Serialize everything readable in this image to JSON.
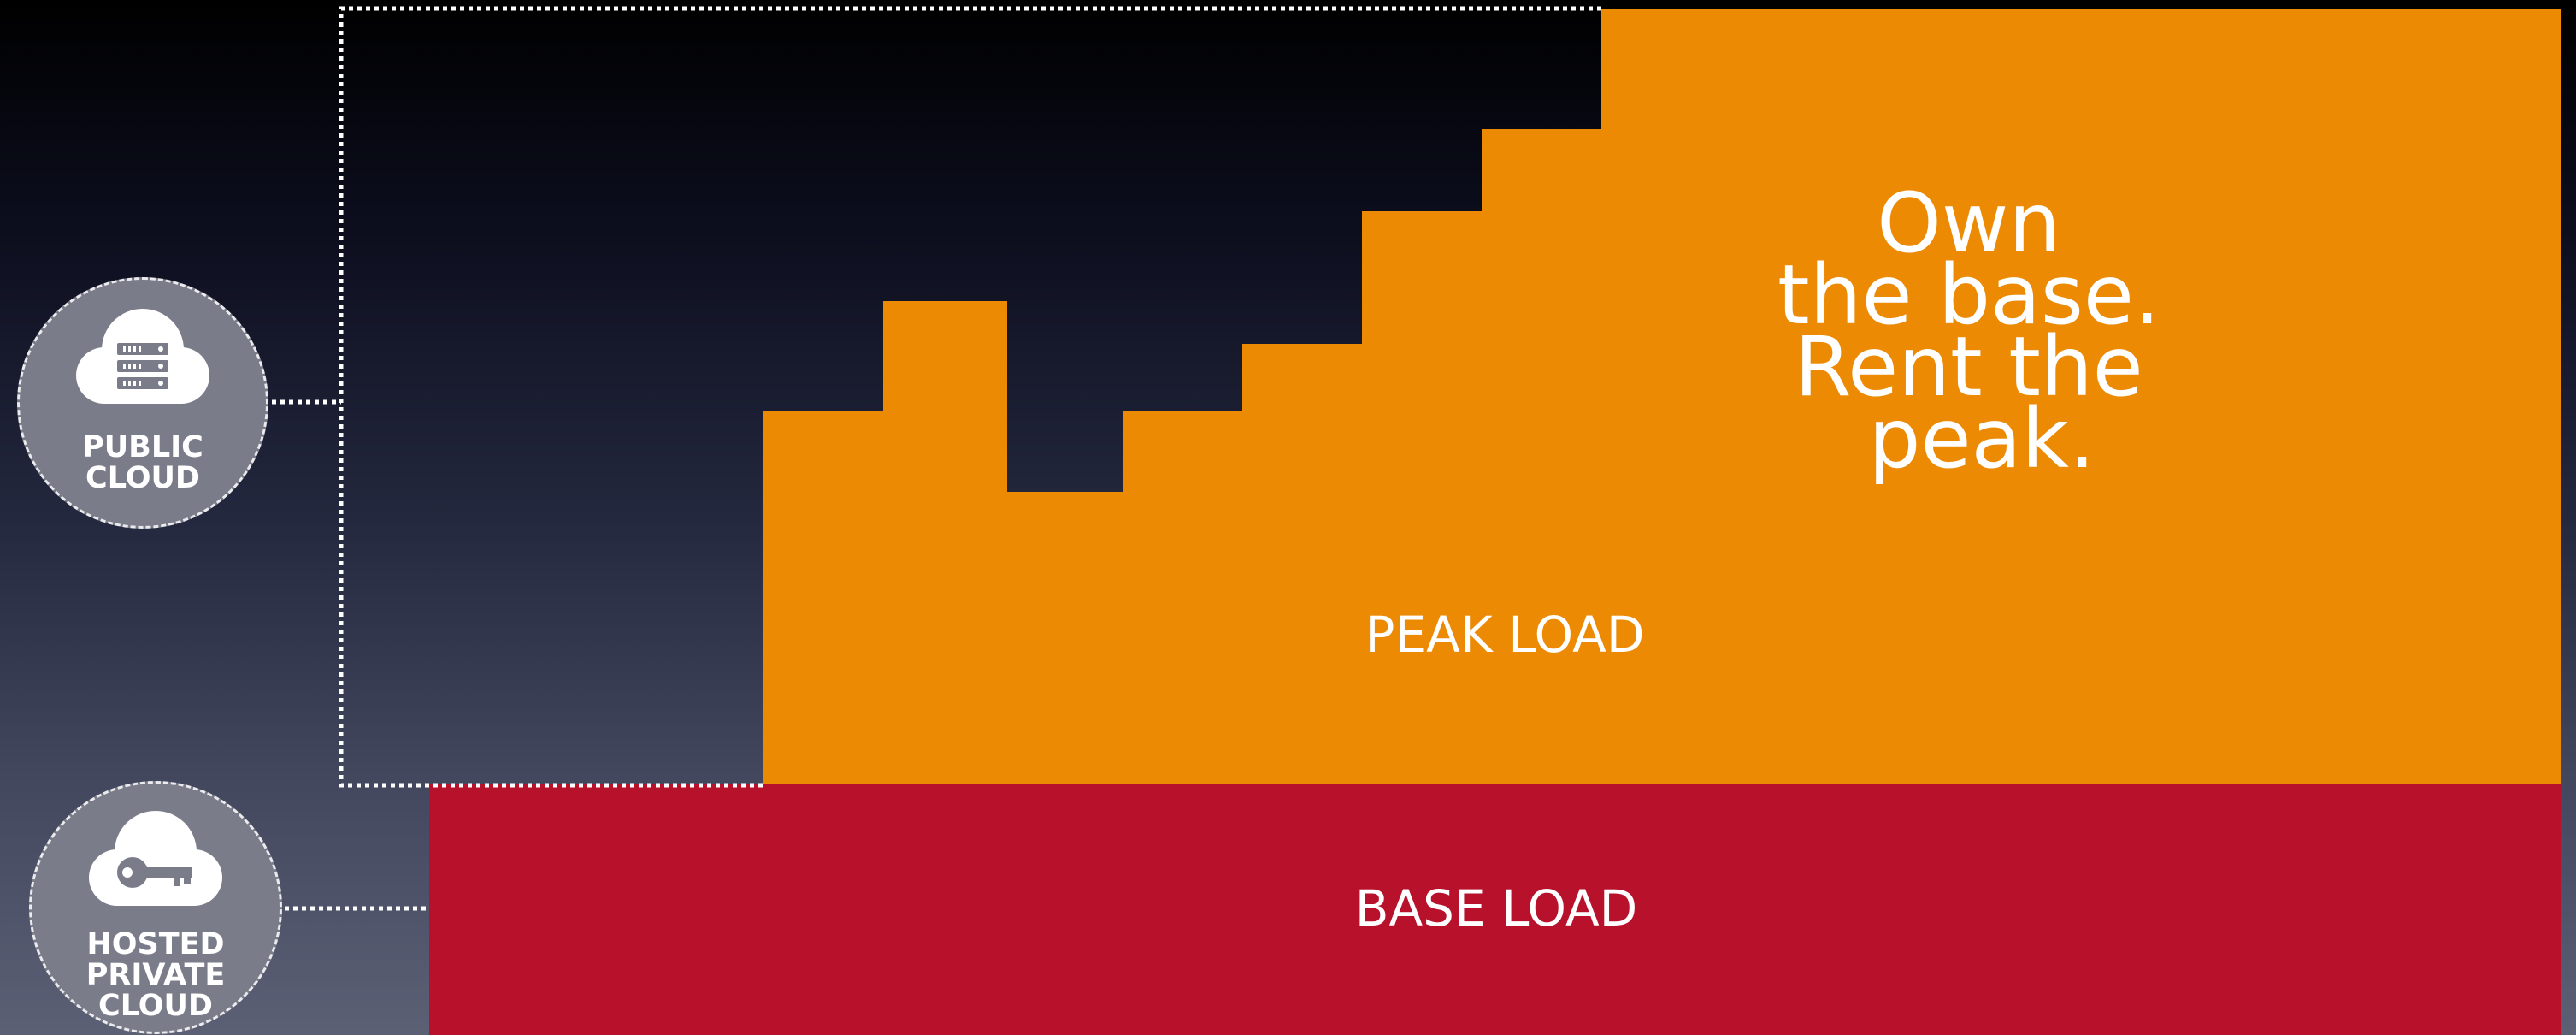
{
  "headline": [
    "Own",
    "the base.",
    "Rent the",
    "peak."
  ],
  "peak_label": "PEAK LOAD",
  "base_label": "BASE LOAD",
  "public_cloud": {
    "label": "PUBLIC\nCLOUD",
    "icon": "server-cloud-icon"
  },
  "private_cloud": {
    "label": "HOSTED\nPRIVATE\nCLOUD",
    "icon": "key-cloud-icon"
  },
  "colors": {
    "peak": "#ec8a04",
    "base": "#b7112b",
    "badge": "#7a7c89",
    "text": "#ffffff",
    "dotted_line": "#ffffff"
  }
}
